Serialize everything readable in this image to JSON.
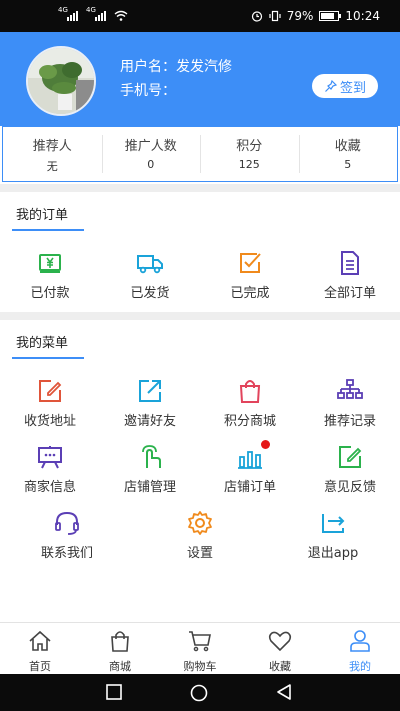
{
  "status_bar": {
    "signal_tag_1": "4G",
    "signal_tag_2": "4G",
    "battery_percent": "79%",
    "time": "10:24"
  },
  "profile": {
    "name_line": "用户名：发发汽修",
    "phone_line": "手机号：",
    "signin_label": "签到"
  },
  "stats": [
    {
      "label": "推荐人",
      "value": "无"
    },
    {
      "label": "推广人数",
      "value": "0"
    },
    {
      "label": "积分",
      "value": "125"
    },
    {
      "label": "收藏",
      "value": "5"
    }
  ],
  "orders": {
    "title": "我的订单",
    "items": [
      {
        "label": "已付款",
        "icon": "yuan-wallet-icon",
        "color": "#2bb24c"
      },
      {
        "label": "已发货",
        "icon": "truck-icon",
        "color": "#1aa3d9"
      },
      {
        "label": "已完成",
        "icon": "check-box-icon",
        "color": "#f08a1c"
      },
      {
        "label": "全部订单",
        "icon": "document-list-icon",
        "color": "#5b3fb5"
      }
    ]
  },
  "menu": {
    "title": "我的菜单",
    "items": [
      {
        "label": "收货地址",
        "icon": "edit-address-icon",
        "color": "#e0553a"
      },
      {
        "label": "邀请好友",
        "icon": "share-arrow-icon",
        "color": "#1aa3d9"
      },
      {
        "label": "积分商城",
        "icon": "shopping-bag-icon",
        "color": "#e2445c"
      },
      {
        "label": "推荐记录",
        "icon": "org-chart-icon",
        "color": "#5b3fb5"
      },
      {
        "label": "商家信息",
        "icon": "easel-board-icon",
        "color": "#5b3fb5"
      },
      {
        "label": "店铺管理",
        "icon": "tap-hand-icon",
        "color": "#2bb24c"
      },
      {
        "label": "店铺订单",
        "icon": "bar-chart-icon",
        "color": "#1aa3d9"
      },
      {
        "label": "意见反馈",
        "icon": "edit-feedback-icon",
        "color": "#2bb24c"
      },
      {
        "label": "联系我们",
        "icon": "headset-icon",
        "color": "#5b3fb5"
      },
      {
        "label": "设置",
        "icon": "gear-icon",
        "color": "#f08a1c"
      },
      {
        "label": "退出app",
        "icon": "exit-arrow-icon",
        "color": "#1aa3d9"
      }
    ]
  },
  "tabbar": [
    {
      "label": "首页",
      "icon": "home-icon"
    },
    {
      "label": "商城",
      "icon": "bag-icon"
    },
    {
      "label": "购物车",
      "icon": "cart-icon"
    },
    {
      "label": "收藏",
      "icon": "heart-icon"
    },
    {
      "label": "我的",
      "icon": "user-icon",
      "active": true
    }
  ],
  "colors": {
    "primary": "#3d8ef7",
    "badge": "#e51919"
  }
}
